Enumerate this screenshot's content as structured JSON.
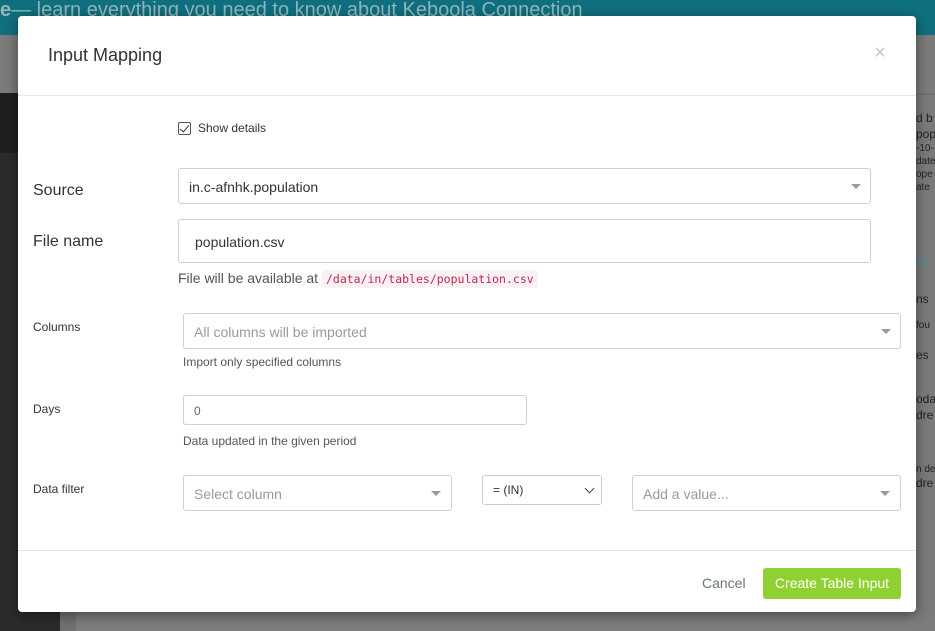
{
  "background": {
    "banner_prefix": "e",
    "banner_text": "— learn everything you need to know about Keboola Connection",
    "right_fragments": [
      "d b",
      "pop",
      "-10-",
      "date",
      "ope",
      "ate",
      "",
      "",
      "e t",
      "",
      "ns",
      "",
      "fou",
      "",
      "es",
      "",
      "oda",
      "dre",
      "",
      "",
      "n de",
      "dre"
    ]
  },
  "modal": {
    "title": "Input Mapping",
    "close_glyph": "×",
    "show_details_label": "Show details",
    "source": {
      "label": "Source",
      "value": "in.c-afnhk.population"
    },
    "file_name": {
      "label": "File name",
      "value": "population.csv",
      "help_prefix": "File will be available at",
      "help_path": "/data/in/tables/population.csv"
    },
    "columns": {
      "label": "Columns",
      "placeholder": "All columns will be imported",
      "help": "Import only specified columns"
    },
    "days": {
      "label": "Days",
      "value": "0",
      "help": "Data updated in the given period"
    },
    "data_filter": {
      "label": "Data filter",
      "column_placeholder": "Select column",
      "operator": "= (IN)",
      "value_placeholder": "Add a value..."
    },
    "footer": {
      "cancel_label": "Cancel",
      "create_label": "Create Table Input"
    }
  },
  "colors": {
    "primary_button": "#8fd131",
    "code_text": "#c7254e",
    "banner": "#0f6f7e"
  }
}
